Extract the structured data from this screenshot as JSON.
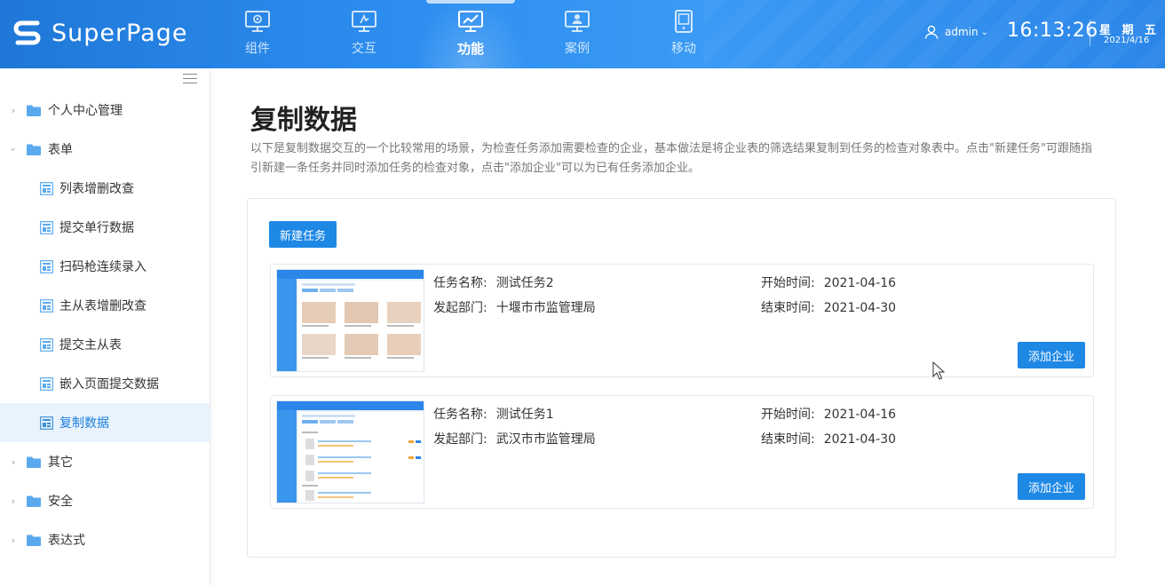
{
  "header": {
    "logo_text": "SuperPage",
    "nav": [
      {
        "label": "组件",
        "icon": "settings-monitor-icon",
        "active": false
      },
      {
        "label": "交互",
        "icon": "interaction-monitor-icon",
        "active": false
      },
      {
        "label": "功能",
        "icon": "chart-monitor-icon",
        "active": true
      },
      {
        "label": "案例",
        "icon": "user-monitor-icon",
        "active": false
      },
      {
        "label": "移动",
        "icon": "tablet-icon",
        "active": false
      }
    ],
    "user": "admin",
    "time": "16:13:26",
    "weekday": "星 期 五",
    "date": "2021/4/16"
  },
  "sidebar": {
    "groups": [
      {
        "label": "个人中心管理",
        "expanded": false
      },
      {
        "label": "表单",
        "expanded": true
      },
      {
        "label": "其它",
        "expanded": false
      },
      {
        "label": "安全",
        "expanded": false
      },
      {
        "label": "表达式",
        "expanded": false
      }
    ],
    "form_items": [
      {
        "label": "列表增删改查",
        "active": false
      },
      {
        "label": "提交单行数据",
        "active": false
      },
      {
        "label": "扫码枪连续录入",
        "active": false
      },
      {
        "label": "主从表增删改查",
        "active": false
      },
      {
        "label": "提交主从表",
        "active": false
      },
      {
        "label": "嵌入页面提交数据",
        "active": false
      },
      {
        "label": "复制数据",
        "active": true
      }
    ]
  },
  "main": {
    "title": "复制数据",
    "description": "以下是复制数据交互的一个比较常用的场景，为检查任务添加需要检查的企业，基本做法是将企业表的筛选结果复制到任务的检查对象表中。点击\"新建任务\"可跟随指引新建一条任务并同时添加任务的检查对象，点击\"添加企业\"可以为已有任务添加企业。",
    "new_task_label": "新建任务",
    "labels": {
      "task_name": "任务名称:",
      "department": "发起部门:",
      "start_time": "开始时间:",
      "end_time": "结束时间:",
      "add_company": "添加企业"
    },
    "tasks": [
      {
        "name": "测试任务2",
        "department": "十堰市市监管理局",
        "start": "2021-04-16",
        "end": "2021-04-30"
      },
      {
        "name": "测试任务1",
        "department": "武汉市市监管理局",
        "start": "2021-04-16",
        "end": "2021-04-30"
      }
    ]
  },
  "colors": {
    "header_blue": "#2d8ef0",
    "primary_button": "#1e88e5",
    "active_menu_bg": "#e8f3fd",
    "active_menu_text": "#1e7fd9"
  }
}
